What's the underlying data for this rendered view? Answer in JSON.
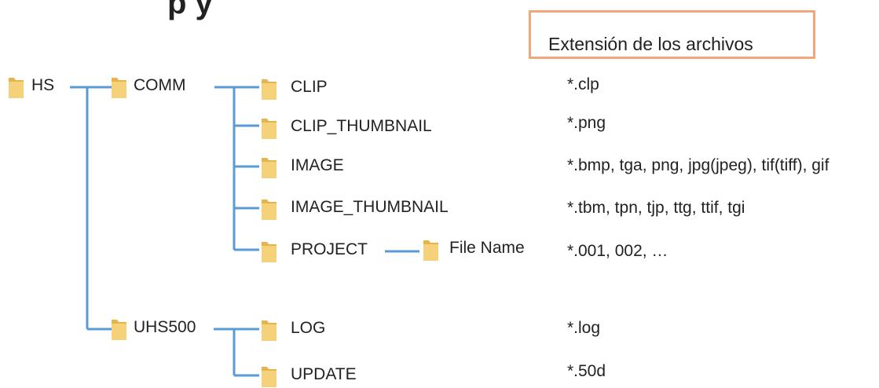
{
  "title_fragment": "p          y",
  "extension_header": "Extensión de los archivos",
  "tree": {
    "root": "HS",
    "comm": "COMM",
    "uhs500": "UHS500",
    "clip": "CLIP",
    "clip_thumbnail": "CLIP_THUMBNAIL",
    "image": "IMAGE",
    "image_thumbnail": "IMAGE_THUMBNAIL",
    "project": "PROJECT",
    "file_name": "File Name",
    "log": "LOG",
    "update": "UPDATE"
  },
  "extensions": {
    "clip": "*.clp",
    "clip_thumbnail": "*.png",
    "image": "*.bmp, tga, png, jpg(jpeg), tif(tiff), gif",
    "image_thumbnail": "*.tbm, tpn, tjp, ttg, ttif, tgi",
    "project": "*.001, 002, …",
    "log": "*.log",
    "update": "*.50d"
  },
  "colors": {
    "connector": "#5b9bd5",
    "folder": "#f5d27a",
    "folder_dark": "#e6b44c",
    "header_border": "#f0a77c"
  },
  "icons": {
    "folder": "folder-icon"
  }
}
